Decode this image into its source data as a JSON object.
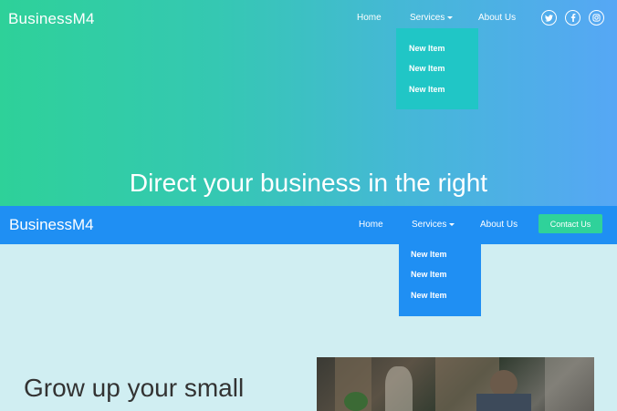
{
  "hero": {
    "brand": "BusinessM4",
    "nav": {
      "home": "Home",
      "services": "Services",
      "about": "About Us"
    },
    "dropdown_items": [
      "New Item",
      "New Item",
      "New Item"
    ],
    "headline": "Direct your business in the right",
    "social": [
      "twitter-icon",
      "facebook-icon",
      "instagram-icon"
    ]
  },
  "navbar2": {
    "brand": "BusinessM4",
    "nav": {
      "home": "Home",
      "services": "Services",
      "about": "About Us"
    },
    "contact": "Contact Us",
    "dropdown_items": [
      "New Item",
      "New Item",
      "New Item"
    ]
  },
  "content": {
    "title": "Grow up your small"
  },
  "colors": {
    "gradient_start": "#2ed199",
    "gradient_end": "#56a7f5",
    "navbar2_bg": "#1f8ff3",
    "contact_button": "#2fd29a",
    "content_bg": "#d0eef2"
  }
}
